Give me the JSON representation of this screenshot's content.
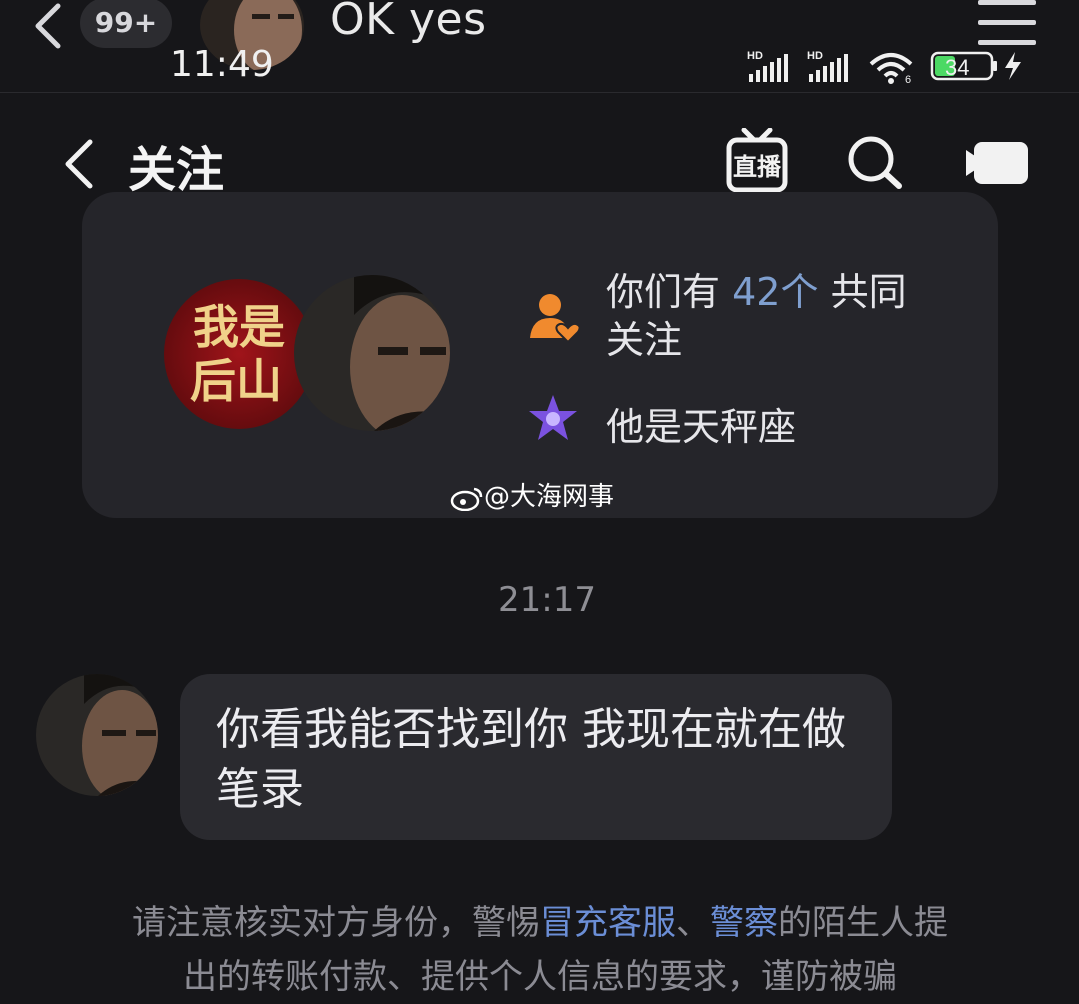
{
  "top": {
    "badge": "99+",
    "title": "OK yes",
    "time": "11:49",
    "battery": "34"
  },
  "header": {
    "title": "关注",
    "live_label": "直播"
  },
  "card": {
    "avatar_a_text": [
      "我是",
      "后山"
    ],
    "mutual_prefix": "你们有",
    "mutual_count": "42个",
    "mutual_suffix": "共同关注",
    "zodiac": "他是天秤座"
  },
  "watermark": "@大海网事",
  "timestamp": "21:17",
  "message": {
    "text": "你看我能否找到你 我现在就在做笔录"
  },
  "notice": {
    "line1_a": "请注意核实对方身份，警惕",
    "line1_b": "冒充客服",
    "line1_c": "、",
    "line1_d": "警察",
    "line1_e": "的陌生人提",
    "line2": "出的转账付款、提供个人信息的要求，谨防被骗"
  },
  "colors": {
    "background": "#161619",
    "card": "#25252a",
    "accent_blue": "#7f9fcf",
    "mutual_icon": "#f08a2e",
    "zodiac_icon": "#8b5cf6"
  }
}
